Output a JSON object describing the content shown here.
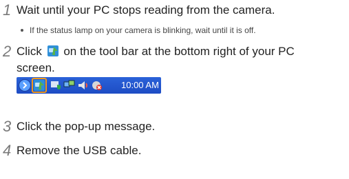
{
  "steps": [
    {
      "number": "1",
      "text": "Wait until your PC stops reading from the camera."
    },
    {
      "number": "2",
      "text_before_icon": "Click",
      "text_after_icon": "on the tool bar at the bottom right of your PC",
      "text_line2": "screen."
    },
    {
      "number": "3",
      "text": "Click the pop-up message."
    },
    {
      "number": "4",
      "text": "Remove the USB cable."
    }
  ],
  "bullet": "If the status lamp on your camera is blinking, wait until it is off.",
  "taskbar": {
    "time": "10:00 AM",
    "icons": [
      "expand-arrow-icon",
      "safely-remove-hardware-icon",
      "security-shield-icon",
      "network-icon",
      "volume-icon",
      "network-disconnected-icon"
    ]
  },
  "colors": {
    "step_number": "#7a7a7a",
    "taskbar": "#2457d2",
    "highlight": "#f29a1a"
  }
}
